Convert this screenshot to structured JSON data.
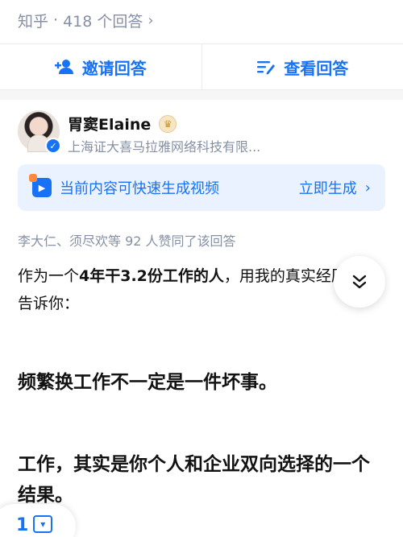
{
  "topbar": {
    "brand": "知乎",
    "separator": "·",
    "answers_count": "418 个回答",
    "chevron": "›"
  },
  "actions": {
    "invite_icon": "person-plus-icon",
    "invite_label": "邀请回答",
    "view_icon": "list-edit-icon",
    "view_label": "查看回答"
  },
  "author": {
    "name": "胃窦Elaine",
    "badge_icon": "crown-icon",
    "verified_icon": "check-icon",
    "org": "上海证大喜马拉雅网络科技有限..."
  },
  "gen_video": {
    "icon": "video-icon",
    "text": "当前内容可快速生成视频",
    "link": "立即生成",
    "arrow": "›"
  },
  "upvoters": "李大仁、须尽欢等 92 人赞同了该回答",
  "answer": {
    "p1_prefix": "作为一个",
    "p1_bold": "4年干3.2份工作的人",
    "p1_suffix": "，用我的真实经历告诉你：",
    "h1": "频繁换工作不一定是一件坏事。",
    "h2": "工作，其实是你个人和企业双向选择的一个结果。"
  },
  "collapse_icon": "double-chevron-down-icon",
  "bottom": {
    "count": "1",
    "icon": "comment-icon"
  },
  "colors": {
    "accent": "#1772f6",
    "muted": "#8590a6",
    "banner_bg": "#ebf2ff"
  }
}
